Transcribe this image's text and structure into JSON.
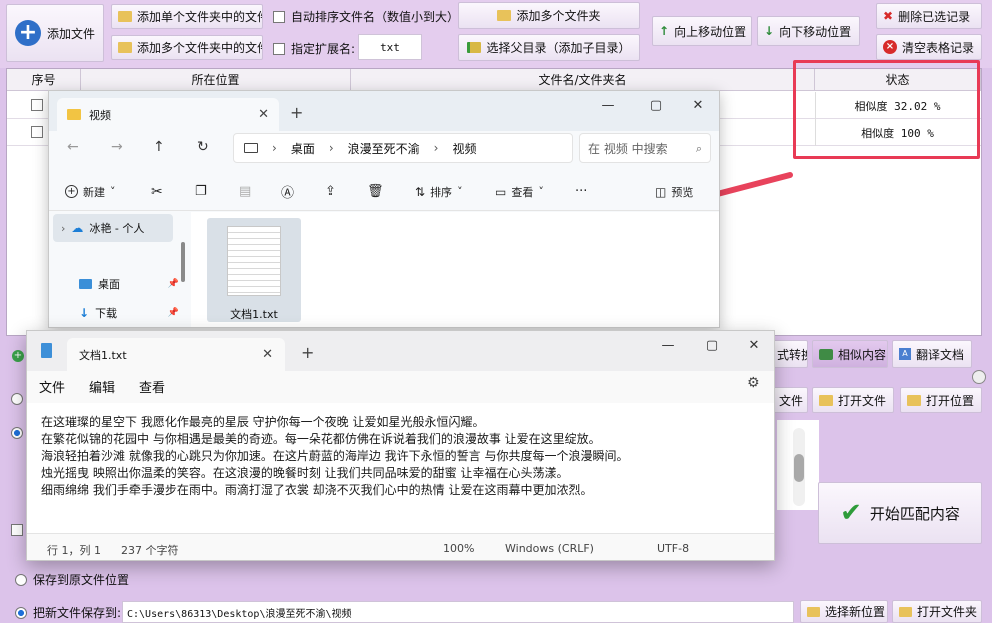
{
  "toolbar": {
    "add_file": "添加文件",
    "add_single_folder_files": "添加单个文件夹中的文件",
    "add_multi_folder_files": "添加多个文件夹中的文件",
    "auto_sort": "自动排序文件名（数值小到大）",
    "specify_ext": "指定扩展名:",
    "ext_value": "txt",
    "add_multi_folders": "添加多个文件夹",
    "select_parent_dir": "选择父目录（添加子目录）",
    "move_up": "向上移动位置",
    "move_down": "向下移动位置",
    "delete_selected": "删除已选记录",
    "clear_table": "清空表格记录"
  },
  "table": {
    "headers": [
      "序号",
      "所在位置",
      "文件名/文件夹名",
      "状态"
    ],
    "rows": [
      {
        "status": "相似度 32.02 %"
      },
      {
        "status": "相似度 100 %"
      }
    ]
  },
  "explorer": {
    "tab_title": "视频",
    "new_tab": "+",
    "address": [
      "桌面",
      "浪漫至死不渝",
      "视频"
    ],
    "search_placeholder": "在 视频 中搜索",
    "cmd_new": "新建",
    "cmd_sort": "排序",
    "cmd_view": "查看",
    "cmd_more": "···",
    "cmd_preview": "预览",
    "nav_cloud": "冰艳 - 个人",
    "nav_desktop": "桌面",
    "nav_downloads": "下载",
    "file_name": "文档1.txt"
  },
  "notepad": {
    "tab_title": "文档1.txt",
    "new_tab": "+",
    "menu": [
      "文件",
      "编辑",
      "查看"
    ],
    "lines": [
      "在这璀璨的星空下 我愿化作最亮的星辰 守护你每一个夜晚 让爱如星光般永恒闪耀。",
      "在繁花似锦的花园中 与你相遇是最美的奇迹。每一朵花都仿佛在诉说着我们的浪漫故事 让爱在这里绽放。",
      "海浪轻拍着沙滩 就像我的心跳只为你加速。在这片蔚蓝的海岸边 我许下永恒的誓言 与你共度每一个浪漫瞬间。",
      "烛光摇曳 映照出你温柔的笑容。在这浪漫的晚餐时刻 让我们共同品味爱的甜蜜 让幸福在心头荡漾。",
      "细雨绵绵 我们手牵手漫步在雨中。雨滴打湿了衣裳 却浇不灭我们心中的热情 让爱在这雨幕中更加浓烈。"
    ],
    "status_pos": "行 1，列 1",
    "status_chars": "237 个字符",
    "status_zoom": "100%",
    "status_eol": "Windows (CRLF)",
    "status_enc": "UTF-8"
  },
  "side_buttons": {
    "convert": "式转换",
    "similar_content": "相似内容",
    "translate_doc": "翻译文档",
    "file_partial": "文件",
    "open_file": "打开文件",
    "open_location": "打开位置",
    "start_match": "开始匹配内容"
  },
  "bottom": {
    "save_original": "保存到原文件位置",
    "save_new": "把新文件保存到:",
    "save_path": "C:\\Users\\86313\\Desktop\\浪漫至死不渝\\视频",
    "choose_location": "选择新位置",
    "open_folder": "打开文件夹"
  },
  "colors": {
    "accent": "#e83a55",
    "app_bg": "#dcc3ea",
    "arrow": "#e8435c"
  }
}
